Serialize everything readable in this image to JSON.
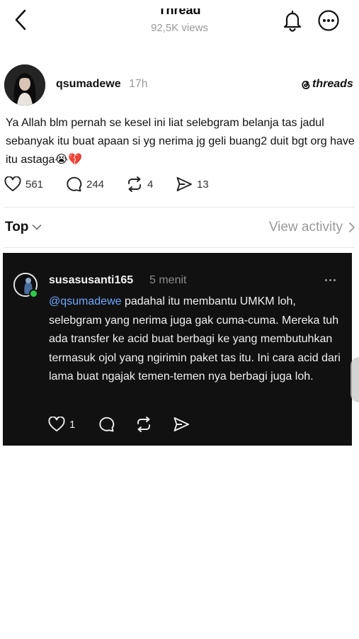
{
  "header": {
    "title": "Thread",
    "views": "92,5K views"
  },
  "post": {
    "username": "qsumadewe",
    "time": "17h",
    "brand": "threads",
    "text": "Ya Allah blm pernah se kesel ini liat selebgram belanja tas jadul sebanyak itu buat apaan si yg nerima jg geli buang2 duit bgt org have itu astaga😭💔",
    "likes": "561",
    "replies": "244",
    "reposts": "4",
    "shares": "13"
  },
  "sort": {
    "label": "Top",
    "view_activity": "View activity"
  },
  "reply": {
    "username": "susasusanti165",
    "time": "5 menit",
    "mention": "@qsumadewe",
    "text": "padahal itu membantu UMKM loh, selebgram yang nerima juga gak cuma-cuma. Mereka tuh ada transfer ke acid buat berbagi ke yang membutuhkan termasuk ojol yang ngirimin paket tas itu. Ini cara acid dari lama buat ngajak temen-temen nya berbagi juga loh.",
    "likes": "1"
  },
  "colors": {
    "accent_link": "#6ea8ff",
    "online": "#2ec84a",
    "card_bg": "#111111"
  },
  "icons": [
    "back-icon",
    "bell-icon",
    "more-icon",
    "heart-icon",
    "comment-icon",
    "repost-icon",
    "share-icon",
    "chevron-down-icon",
    "chevron-right-icon",
    "threads-logo-icon"
  ]
}
